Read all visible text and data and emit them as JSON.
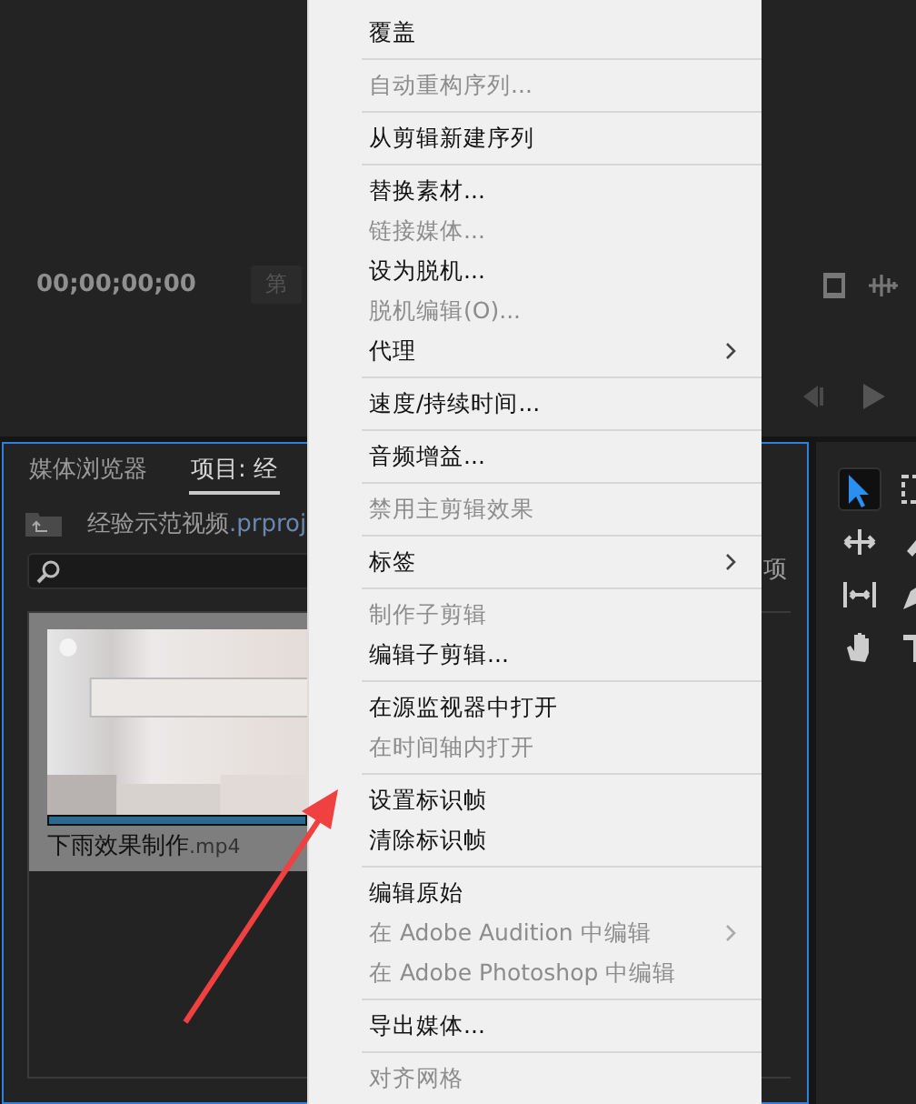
{
  "monitor": {
    "timecode": "00;00;00;00",
    "zoom_button": "第"
  },
  "project_panel": {
    "tabs": [
      {
        "label": "媒体浏览器",
        "selected": false
      },
      {
        "label": "项目: 经",
        "selected": true
      }
    ],
    "project_name": "经验示范视频",
    "project_extension": ".prproj",
    "clip": {
      "name": "下雨效果制作",
      "extension": ".mp4"
    },
    "cut_label": "项"
  },
  "tools": [
    {
      "kind": "select",
      "selected": true
    },
    {
      "kind": "track-select",
      "selected": false
    },
    {
      "kind": "ripple",
      "selected": false
    },
    {
      "kind": "razor",
      "selected": false
    },
    {
      "kind": "slip",
      "selected": false
    },
    {
      "kind": "pen",
      "selected": false
    },
    {
      "kind": "hand",
      "selected": false
    },
    {
      "kind": "type",
      "selected": false
    }
  ],
  "context_menu": {
    "items": [
      {
        "kind": "item",
        "label": "覆盖",
        "disabled": false,
        "submenu": false
      },
      {
        "kind": "separator"
      },
      {
        "kind": "item",
        "label": "自动重构序列...",
        "disabled": true,
        "submenu": false
      },
      {
        "kind": "separator"
      },
      {
        "kind": "item",
        "label": "从剪辑新建序列",
        "disabled": false,
        "submenu": false
      },
      {
        "kind": "separator"
      },
      {
        "kind": "item",
        "label": "替换素材...",
        "disabled": false,
        "submenu": false
      },
      {
        "kind": "item",
        "label": "链接媒体...",
        "disabled": true,
        "submenu": false
      },
      {
        "kind": "item",
        "label": "设为脱机...",
        "disabled": false,
        "submenu": false
      },
      {
        "kind": "item",
        "label": "脱机编辑(O)...",
        "disabled": true,
        "submenu": false
      },
      {
        "kind": "item",
        "label": "代理",
        "disabled": false,
        "submenu": true
      },
      {
        "kind": "separator"
      },
      {
        "kind": "item",
        "label": "速度/持续时间...",
        "disabled": false,
        "submenu": false
      },
      {
        "kind": "separator"
      },
      {
        "kind": "item",
        "label": "音频增益...",
        "disabled": false,
        "submenu": false
      },
      {
        "kind": "separator"
      },
      {
        "kind": "item",
        "label": "禁用主剪辑效果",
        "disabled": true,
        "submenu": false
      },
      {
        "kind": "separator"
      },
      {
        "kind": "item",
        "label": "标签",
        "disabled": false,
        "submenu": true
      },
      {
        "kind": "separator"
      },
      {
        "kind": "item",
        "label": "制作子剪辑",
        "disabled": true,
        "submenu": false
      },
      {
        "kind": "item",
        "label": "编辑子剪辑...",
        "disabled": false,
        "submenu": false
      },
      {
        "kind": "separator"
      },
      {
        "kind": "item",
        "label": "在源监视器中打开",
        "disabled": false,
        "submenu": false
      },
      {
        "kind": "item",
        "label": "在时间轴内打开",
        "disabled": true,
        "submenu": false
      },
      {
        "kind": "separator"
      },
      {
        "kind": "item",
        "label": "设置标识帧",
        "disabled": false,
        "submenu": false
      },
      {
        "kind": "item",
        "label": "清除标识帧",
        "disabled": false,
        "submenu": false
      },
      {
        "kind": "separator"
      },
      {
        "kind": "item",
        "label": "编辑原始",
        "disabled": false,
        "submenu": false
      },
      {
        "kind": "item",
        "label": "在 Adobe Audition 中编辑",
        "disabled": true,
        "submenu": true
      },
      {
        "kind": "item",
        "label": "在 Adobe Photoshop 中编辑",
        "disabled": true,
        "submenu": false
      },
      {
        "kind": "separator"
      },
      {
        "kind": "item",
        "label": "导出媒体...",
        "disabled": false,
        "submenu": false
      },
      {
        "kind": "separator"
      },
      {
        "kind": "item",
        "label": "对齐网格",
        "disabled": true,
        "submenu": false
      }
    ]
  }
}
